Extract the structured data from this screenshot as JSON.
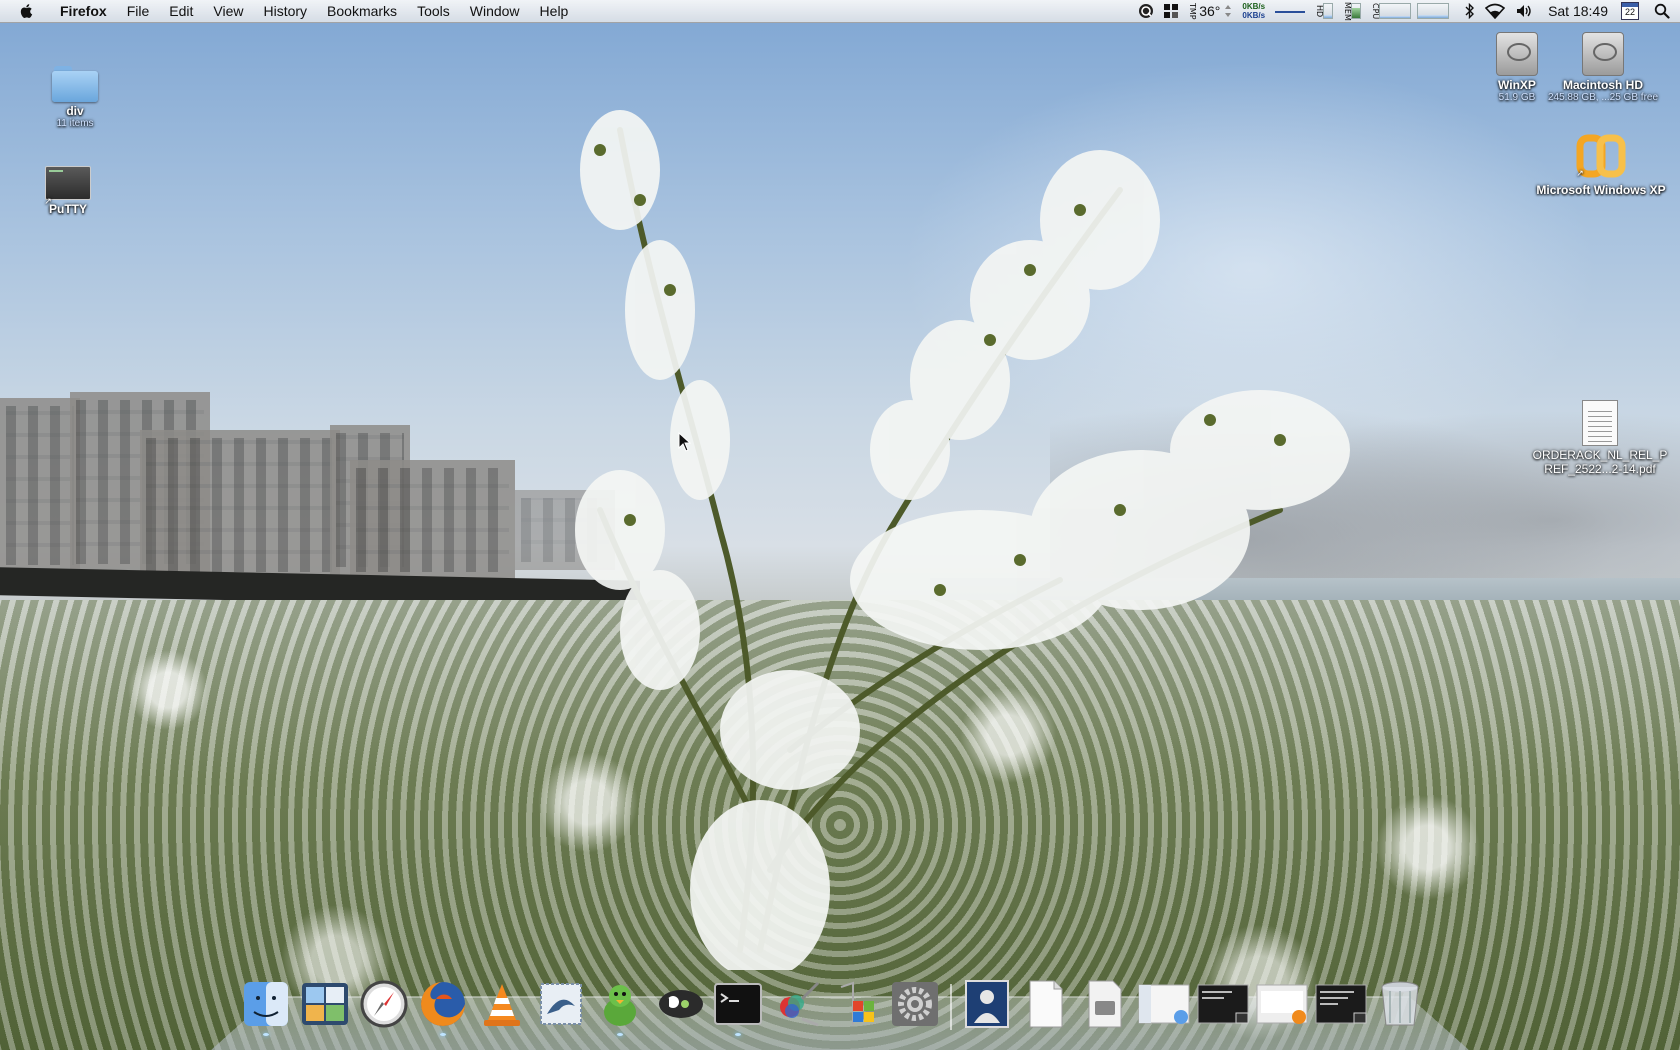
{
  "menubar": {
    "app_name": "Firefox",
    "menus": [
      "File",
      "Edit",
      "View",
      "History",
      "Bookmarks",
      "Tools",
      "Window",
      "Help"
    ],
    "temperature": "36°",
    "temp_label": "TMP",
    "net_down": "0KB/s",
    "net_up": "0KB/s",
    "mem_label": "MEM",
    "disk_label": "HD",
    "cpu_label": "CPU",
    "clock": "Sat 18:49",
    "calendar_day": "22"
  },
  "desktop": {
    "icons_left": [
      {
        "label": "div",
        "sub": "11 items"
      },
      {
        "label": "PuTTY",
        "sub": ""
      }
    ],
    "icons_right": [
      {
        "label": "WinXP",
        "sub": "51.9 GB"
      },
      {
        "label": "Macintosh HD",
        "sub": "245.88 GB, ...25 GB free"
      },
      {
        "label": "Microsoft Windows XP",
        "sub": ""
      },
      {
        "label": "ORDERACK_NL_REL_P REF_2522...2-14.pdf",
        "sub": ""
      }
    ]
  },
  "dock": {
    "items": [
      "Finder",
      "Dashboard",
      "Safari",
      "Firefox",
      "VLC",
      "Mail",
      "Adium",
      "Growl",
      "Terminal",
      "ColorSync",
      "Boot Camp",
      "System Preferences",
      "Preview",
      "Documents",
      "Disk",
      "Finder Window",
      "Terminal Window",
      "Firefox Window",
      "Terminal Window 2",
      "Trash"
    ]
  },
  "colors": {
    "menubar_bg": "#e8eaed",
    "label_shadow": "#000000",
    "dock_glow": "#bfe4ff"
  }
}
